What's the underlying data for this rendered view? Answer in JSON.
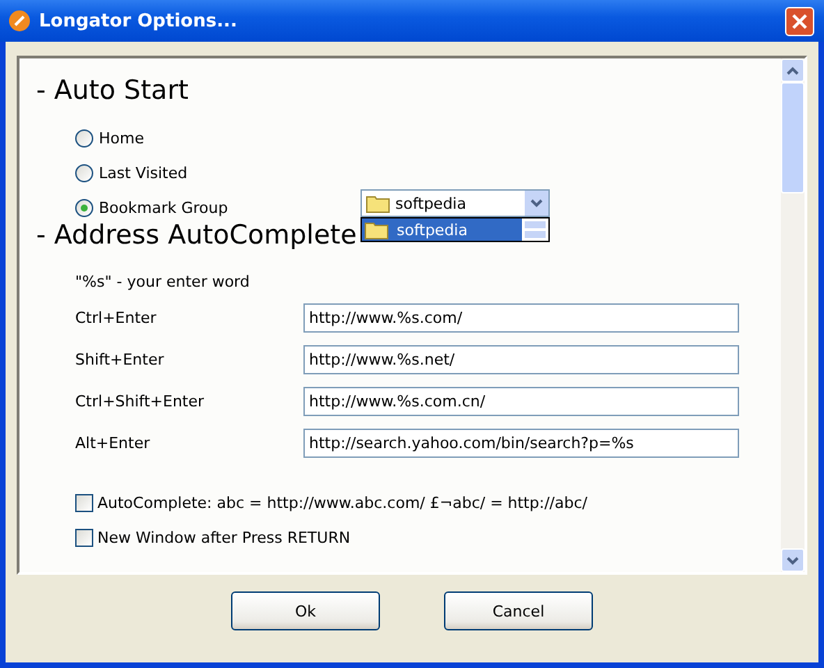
{
  "window": {
    "title": "Longator Options..."
  },
  "auto_start": {
    "heading": "- Auto Start",
    "options": [
      {
        "label": "Home",
        "selected": false
      },
      {
        "label": "Last Visited",
        "selected": false
      },
      {
        "label": "Bookmark Group",
        "selected": true
      }
    ],
    "group_dropdown": {
      "value": "softpedia",
      "expanded": true,
      "items": [
        {
          "label": "softpedia",
          "selected": true
        }
      ]
    }
  },
  "address_autocomplete": {
    "heading": "- Address AutoComplete",
    "hint": "\"%s\" - your enter word",
    "rows": [
      {
        "label": "Ctrl+Enter",
        "value": "http://www.%s.com/"
      },
      {
        "label": "Shift+Enter",
        "value": "http://www.%s.net/"
      },
      {
        "label": "Ctrl+Shift+Enter",
        "value": "http://www.%s.com.cn/"
      },
      {
        "label": "Alt+Enter",
        "value": "http://search.yahoo.com/bin/search?p=%s"
      }
    ],
    "checkboxes": [
      {
        "label": "AutoComplete: abc = http://www.abc.com/ £¬abc/ = http://abc/",
        "checked": false
      },
      {
        "label": "New Window after Press RETURN",
        "checked": false
      }
    ]
  },
  "buttons": [
    "Ok",
    "Cancel"
  ]
}
